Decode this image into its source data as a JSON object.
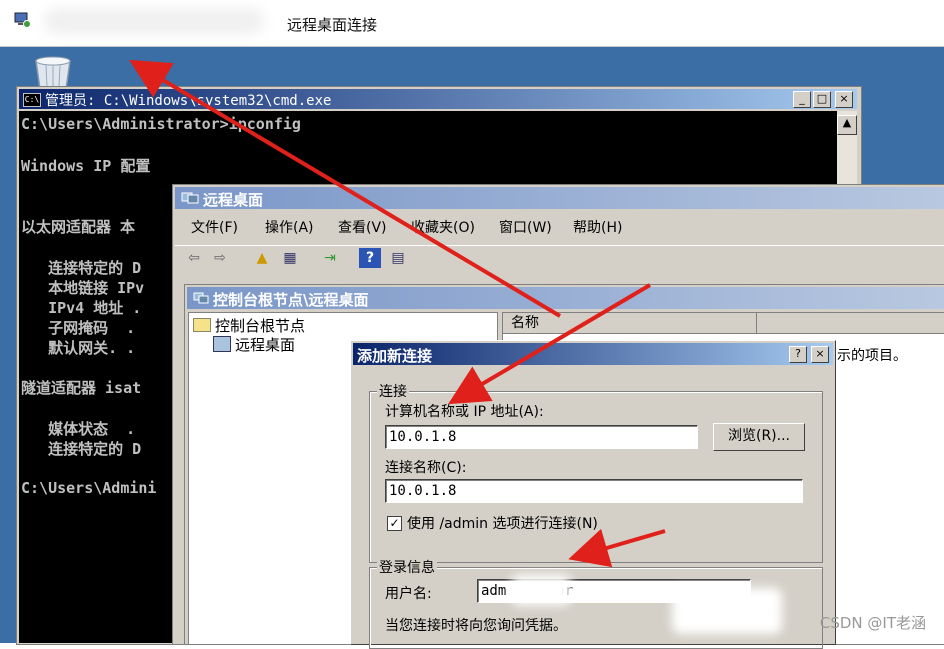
{
  "rdp_window": {
    "title": "远程桌面连接"
  },
  "cmd_window": {
    "title": "管理员: C:\\Windows\\system32\\cmd.exe",
    "icon_label": "C:\\",
    "lines": [
      "C:\\Users\\Administrator>ipconfig",
      "",
      "Windows IP 配置",
      "",
      "",
      "以太网适配器 本",
      "",
      "   连接特定的 D",
      "   本地链接 IPv",
      "   IPv4 地址 .",
      "   子网掩码  .",
      "   默认网关. .",
      "",
      "隧道适配器 isat",
      "",
      "   媒体状态  .",
      "   连接特定的 D",
      "",
      "C:\\Users\\Admini"
    ]
  },
  "mmc_window": {
    "title": "远程桌面",
    "menu": [
      "文件(F)",
      "操作(A)",
      "查看(V)",
      "收藏夹(O)",
      "窗口(W)",
      "帮助(H)"
    ],
    "toolbar_icons": [
      "back-arrow-icon",
      "forward-arrow-icon",
      "up-folder-icon",
      "show-tree-icon",
      "export-icon",
      "help-icon",
      "properties-icon"
    ]
  },
  "console_window": {
    "title": "控制台根节点\\远程桌面",
    "tree": {
      "root": "控制台根节点",
      "child": "远程桌面"
    },
    "list": {
      "column_name": "名称",
      "empty_text": "示的项目。"
    }
  },
  "add_connection_dialog": {
    "title": "添加新连接",
    "help_button": "?",
    "close_button": "×",
    "connection_group": {
      "legend": "连接",
      "computer_label": "计算机名称或 IP 地址(A):",
      "computer_value": "10.0.1.8",
      "browse_button": "浏览(R)...",
      "connection_name_label": "连接名称(C):",
      "connection_name_value": "10.0.1.8",
      "admin_checkbox_label": "使用 /admin 选项进行连接(N)",
      "admin_checked": true
    },
    "login_group": {
      "legend": "登录信息",
      "username_label": "用户名:",
      "username_value_start": "adm",
      "username_value_end": "or",
      "prompt_text": "当您连接时将向您询问凭据。"
    }
  },
  "watermark": "CSDN @IT老涵",
  "colors": {
    "desktop": "#3b6ea5",
    "active_title": "#0a246a",
    "inactive_title": "#7a96c8",
    "arrow": "#e0201a"
  }
}
